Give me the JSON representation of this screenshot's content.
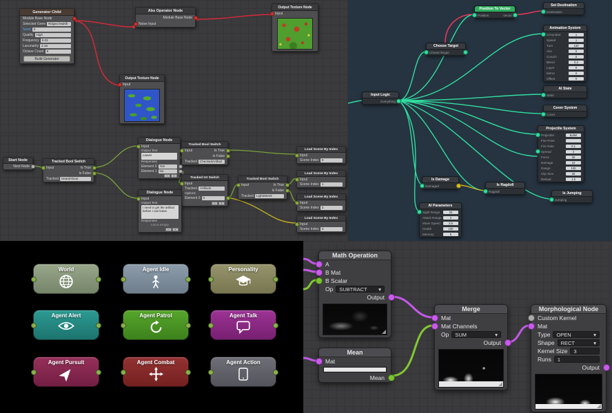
{
  "ui": {
    "dropdown_arrow": "▾",
    "add": "+",
    "remove": "−"
  },
  "colors": {
    "wire_red": "#cc2a3a",
    "wire_green": "#7ca23c",
    "wire_yellow": "#cdb61e",
    "wire_teal": "#2fe0a2",
    "wire_crimson": "#e83858",
    "wire_purple": "#c25ae6",
    "wire_lime": "#84c832",
    "port_purple": "#c85ce8",
    "port_green": "#7cc233",
    "header_green": "#2fae5e"
  },
  "noise_graph": {
    "generator": {
      "title": "Generator Child",
      "output_label": "Module Base Node",
      "fields": [
        {
          "label": "Selected Gene",
          "value": "Ridged Multifr"
        },
        {
          "label": "Seed",
          "value": "0"
        },
        {
          "label": "Quality",
          "value": "High"
        },
        {
          "label": "Frequency",
          "value": "0.03"
        },
        {
          "label": "Lacunarity",
          "value": "2.16"
        },
        {
          "label": "Octave Count",
          "value": "9"
        }
      ],
      "build_button": "Build Generator"
    },
    "abs_node": {
      "title": "Abs Operator Node",
      "output_label": "Module Base Node",
      "input_label": "Noise Input"
    },
    "texture_top": {
      "title": "Output Texture Node",
      "input_label": "Input"
    },
    "texture_mid": {
      "title": "Output Texture Node",
      "input_label": "Input"
    }
  },
  "dialogue_graph": {
    "start_node": {
      "title": "Start Node",
      "next_label": "Next Node"
    },
    "bool_switch_1": {
      "title": "Tracked Bool Switch",
      "input": "Input",
      "is_true": "Is True",
      "is_false": "Is False",
      "tracked": "Tracked",
      "value": "HeardAbout"
    },
    "bool_switch_2": {
      "title": "Tracked Bool Switch",
      "input": "Input",
      "is_true": "Is True",
      "is_false": "Is False",
      "tracked": "Tracked",
      "value": "CheckedArtifact"
    },
    "bool_switch_3": {
      "title": "Tracked Bool Switch",
      "input": "Input",
      "is_true": "Is True",
      "is_false": "Is False",
      "tracked": "Tracked",
      "value": "LightsWork"
    },
    "int_switch": {
      "title": "Tracked Int Switch",
      "input": "Input",
      "tracked": "Tracked",
      "value": "Artifacts",
      "options": "Options",
      "element": "Element 0",
      "element_value": "0"
    },
    "dialogue_1": {
      "title": "Dialogue Node",
      "input": "Input",
      "output_text": "Output Text",
      "text": "Leave!",
      "responses": "Responses",
      "elements": [
        {
          "label": "Element 0",
          "value": "Yes"
        },
        {
          "label": "Element 1",
          "value": "No"
        }
      ]
    },
    "dialogue_2": {
      "title": "Dialogue Node",
      "input": "Input",
      "output_text": "Output Text",
      "text": "I need to get the artifact before I can leave.",
      "responses": "Responses",
      "empty": "List is Empty"
    },
    "load_scene_nodes": [
      {
        "title": "Load Scene By Index",
        "input": "Input",
        "index_label": "Scene Index",
        "index_value": "0"
      },
      {
        "title": "Load Scene By Index",
        "input": "Input",
        "index_label": "Scene Index",
        "index_value": "1"
      },
      {
        "title": "Load Scene By Index",
        "input": "Input",
        "index_label": "Scene Index",
        "index_value": "2"
      },
      {
        "title": "Load Scene By Index",
        "input": "Input",
        "index_label": "Scene Index",
        "index_value": "3"
      }
    ]
  },
  "ai_graph": {
    "input_logic": {
      "title": "Input Logic",
      "port": "Everything"
    },
    "choose_target": {
      "title": "Choose Target",
      "port": "ChosenTarget"
    },
    "position_to_vector": {
      "title": "Position To Vector",
      "in_port": "Position",
      "out_port": "Vector"
    },
    "set_destination": {
      "title": "Set Destination",
      "port": "Destination"
    },
    "animation_system": {
      "title": "Animation System",
      "rows": [
        {
          "label": "Grounded",
          "value": "1"
        },
        {
          "label": "Speed",
          "value": "1"
        },
        {
          "label": "Turn",
          "value": "120"
        },
        {
          "label": "Aim",
          "value": "0"
        },
        {
          "label": "Crouch",
          "value": "0"
        },
        {
          "label": "Blend",
          "value": "0.2"
        },
        {
          "label": "Layer",
          "value": "0"
        },
        {
          "label": "Mirror",
          "value": "0"
        },
        {
          "label": "Offset",
          "value": "0"
        }
      ]
    },
    "ai_state": {
      "title": "AI State",
      "port": "State"
    },
    "cover_system": {
      "title": "Cover System",
      "port": "Cover"
    },
    "projectile_system": {
      "title": "Projectile System",
      "rows": [
        {
          "label": "Projectile",
          "value": "Bullet"
        },
        {
          "label": "Fire Point",
          "value": ""
        },
        {
          "label": "Fire Rate",
          "value": "0.1"
        },
        {
          "label": "Spread",
          "value": "2"
        },
        {
          "label": "Force",
          "value": "30"
        },
        {
          "label": "Damage",
          "value": "10"
        },
        {
          "label": "Range",
          "value": "100"
        },
        {
          "label": "Clip Size",
          "value": "30"
        },
        {
          "label": "Reload",
          "value": "1.5"
        }
      ]
    },
    "is_jumping": {
      "title": "Is Jumping",
      "port": "Jumping"
    },
    "is_damage": {
      "title": "Is Damage",
      "port": "Damaged"
    },
    "is_ragdoll": {
      "title": "Is Ragdoll",
      "port": "Ragdoll"
    },
    "ai_parameters": {
      "title": "AI Parameters",
      "rows": [
        {
          "label": "Sight Range",
          "value": "20"
        },
        {
          "label": "Attack Range",
          "value": "2"
        },
        {
          "label": "Move Speed",
          "value": "3.5"
        },
        {
          "label": "Health",
          "value": "100"
        },
        {
          "label": "Memory",
          "value": "5"
        }
      ]
    }
  },
  "state_grid": {
    "nodes": [
      {
        "title": "World",
        "icon": "globe-icon",
        "color": "#87967a"
      },
      {
        "title": "Agent Idle",
        "icon": "person-icon",
        "color": "#7f8f9e"
      },
      {
        "title": "Personality",
        "icon": "graduation-cap-icon",
        "color": "#88875f"
      },
      {
        "title": "Agent Alert",
        "icon": "eye-icon",
        "color": "#258b84"
      },
      {
        "title": "Agent Patrol",
        "icon": "cycle-arrow-icon",
        "color": "#4b9825"
      },
      {
        "title": "Agent Talk",
        "icon": "speech-bubble-icon",
        "color": "#8d2b85"
      },
      {
        "title": "Agent Pursuit",
        "icon": "navigation-arrow-icon",
        "color": "#87284f"
      },
      {
        "title": "Agent Combat",
        "icon": "move-cross-icon",
        "color": "#872a2a"
      },
      {
        "title": "Agent Action",
        "icon": "tablet-icon",
        "color": "#63636b"
      }
    ]
  },
  "opencv_graph": {
    "math_operation": {
      "title": "Math Operation",
      "a": "A",
      "b_mat": "B Mat",
      "b_scalar": "B Scalar",
      "op": "Op",
      "op_value": "SUBTRACT",
      "output": "Output"
    },
    "mean": {
      "title": "Mean",
      "mat": "Mat",
      "output": "Mean"
    },
    "merge": {
      "title": "Merge",
      "mat": "Mat",
      "mat_channels": "Mat Channels",
      "op": "Op",
      "op_value": "SUM",
      "output": "Output"
    },
    "morphological": {
      "title": "Morphological Node",
      "custom_kernel": "Custom Kernel",
      "mat": "Mat",
      "type": "Type",
      "type_value": "OPEN",
      "shape": "Shape",
      "shape_value": "RECT",
      "kernel_size": "Kernel Size",
      "kernel_size_value": "3",
      "runs": "Runs",
      "runs_value": "1",
      "output": "Output"
    }
  }
}
